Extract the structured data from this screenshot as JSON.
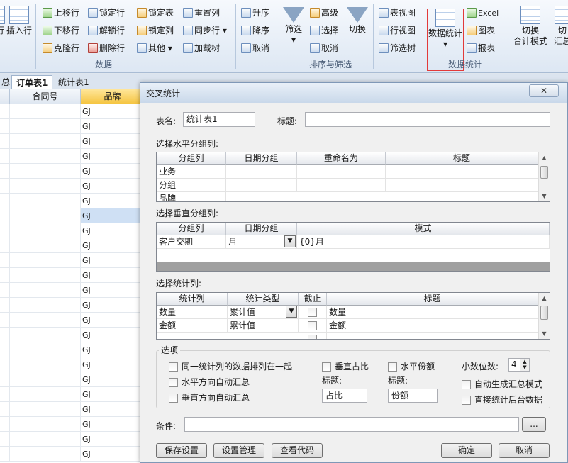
{
  "ribbon": {
    "left_partial": {
      "sum_label": "行",
      "insert_row": "插入行"
    },
    "rows_group": {
      "label": "数据",
      "move_up": "上移行",
      "move_down": "下移行",
      "clone_row": "克隆行",
      "lock_row": "锁定行",
      "unlock_row": "解锁行",
      "delete_row": "删除行",
      "lock_table": "锁定表",
      "lock_col": "锁定列",
      "other": "其他",
      "reset_col": "重置列",
      "sync_row": "同步行",
      "load_tree": "加载树"
    },
    "sort_group": {
      "label": "排序与筛选",
      "asc": "升序",
      "desc": "降序",
      "cancel_sort": "取消",
      "filter": "筛选",
      "advanced": "高级",
      "select": "选择",
      "cancel_filter": "取消",
      "switch": "切换"
    },
    "view_group": {
      "table_view": "表视图",
      "row_view": "行视图",
      "filter_tree": "筛选树"
    },
    "stats_group": {
      "label": "数据统计",
      "data_stats": "数据统计"
    },
    "export_group": {
      "excel": "Excel",
      "chart": "图表",
      "report": "报表"
    },
    "mode_group": {
      "switch_mode_1": "切换",
      "switch_mode_2": "合计模式",
      "switch_sum_1": "切",
      "switch_sum_2": "汇总"
    }
  },
  "sheet_tabs": {
    "partial": "总",
    "tab1": "订单表1",
    "tab2": "统计表1"
  },
  "grid": {
    "col_contract": "合同号",
    "col_brand": "品牌",
    "rows": [
      "GJ",
      "GJ",
      "GJ",
      "GJ",
      "GJ",
      "GJ",
      "GJ",
      "GJ",
      "GJ",
      "GJ",
      "GJ",
      "GJ",
      "GJ",
      "GJ",
      "GJ",
      "GJ",
      "GJ",
      "GJ",
      "GJ",
      "GJ",
      "GJ",
      "GJ",
      "GJ",
      "GJ"
    ]
  },
  "dialog": {
    "title": "交叉统计",
    "close": "✕",
    "table_name_label": "表名:",
    "table_name_value": "统计表1",
    "title_label": "标题:",
    "title_value": "",
    "horizontal": {
      "label": "选择水平分组列:",
      "headers": [
        "分组列",
        "日期分组",
        "重命名为",
        "标题"
      ],
      "rows": [
        "业务",
        "分组",
        "品牌"
      ]
    },
    "vertical": {
      "label": "选择垂直分组列:",
      "headers": [
        "分组列",
        "日期分组",
        "模式"
      ],
      "row": {
        "col": "客户交期",
        "date_group": "月",
        "mode": "{0}月"
      }
    },
    "stats": {
      "label": "选择统计列:",
      "headers": [
        "统计列",
        "统计类型",
        "截止",
        "标题"
      ],
      "rows": [
        {
          "col": "数量",
          "type": "累计值",
          "title": "数量"
        },
        {
          "col": "金额",
          "type": "累计值",
          "title": "金额"
        }
      ]
    },
    "options": {
      "legend": "选项",
      "group_together": "同一统计列的数据排列在一起",
      "h_auto_sum": "水平方向自动汇总",
      "v_auto_sum": "垂直方向自动汇总",
      "v_ratio": "垂直占比",
      "v_ratio_title_label": "标题:",
      "v_ratio_title_value": "占比",
      "h_share": "水平份额",
      "h_share_title_label": "标题:",
      "h_share_title_value": "份额",
      "decimals_label": "小数位数:",
      "decimals_value": "4",
      "auto_sum_mode": "自动生成汇总模式",
      "direct_backend": "直接统计后台数据"
    },
    "condition_label": "条件:",
    "condition_value": "",
    "ellipsis": "...",
    "buttons": {
      "save_settings": "保存设置",
      "manage_settings": "设置管理",
      "view_code": "查看代码",
      "ok": "确定",
      "cancel": "取消"
    }
  }
}
